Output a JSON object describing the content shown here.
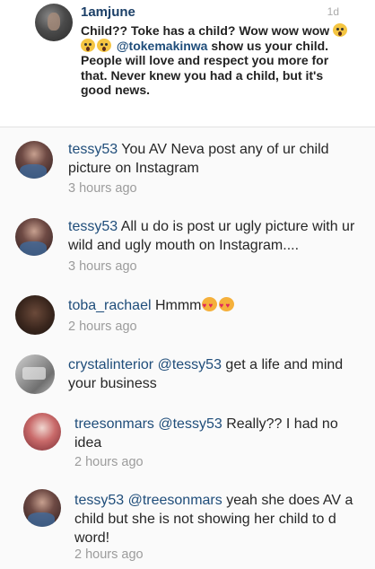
{
  "post": {
    "username": "1amjune",
    "time": "1d",
    "text_before_emoji": "Child?? Toke has a child? Wow wow wow ",
    "emoji_icons": [
      "face-screaming-icon",
      "face-screaming-icon",
      "face-screaming-icon"
    ],
    "mention": "@tokemakinwa",
    "text_after_mention": " show us your child. People will love and respect you more for that. Never knew you had a child, but it's good news."
  },
  "comments": [
    {
      "username": "tessy53",
      "text": " You AV Neva post any of ur child picture on Instagram",
      "time": "3 hours ago",
      "avatar": "tessy53-avatar"
    },
    {
      "username": "tessy53",
      "text": " All u do is post ur ugly picture with ur wild and ugly mouth on Instagram....",
      "time": "3 hours ago",
      "avatar": "tessy53-avatar"
    },
    {
      "username": "toba_rachael",
      "text": " Hmmm",
      "emoji_icons": [
        "heart-eyes-icon",
        "heart-eyes-icon"
      ],
      "time": "2 hours ago",
      "avatar": "toba-rachael-avatar"
    },
    {
      "username": "crystalinterior",
      "mention": " @tessy53",
      "text": " get a life and mind your business",
      "avatar": "crystalinterior-avatar"
    },
    {
      "username": "treesonmars",
      "mention": " @tessy53",
      "text": " Really?? I had no idea",
      "time": "2 hours ago",
      "avatar": "treesonmars-avatar"
    },
    {
      "username": "tessy53",
      "mention": " @treesonmars",
      "text": " yeah she does AV a child but she is not showing her child to d word!",
      "time": "2 hours ago",
      "avatar": "tessy53-avatar"
    }
  ]
}
